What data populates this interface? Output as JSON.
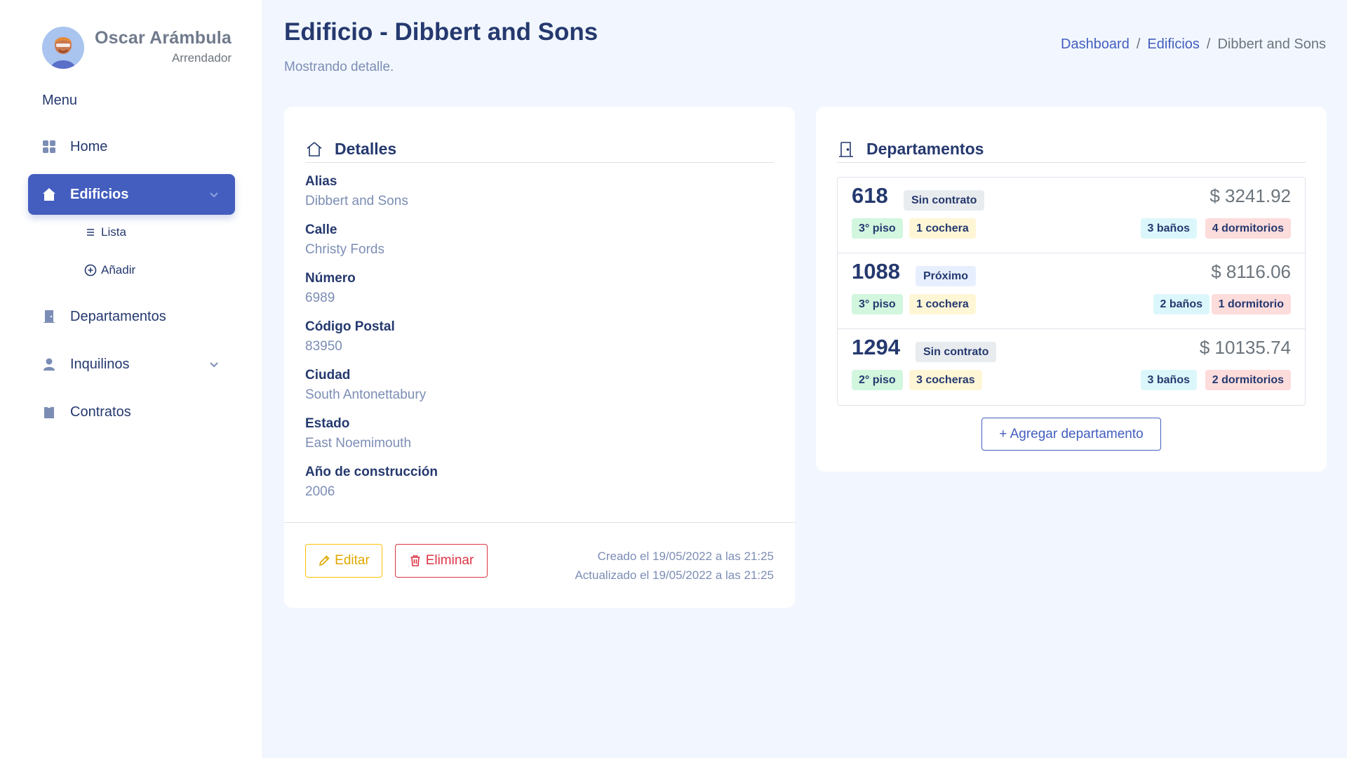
{
  "user": {
    "name": "Oscar Arámbula",
    "role": "Arrendador"
  },
  "sidebar": {
    "menu_title": "Menu",
    "items": [
      {
        "label": "Home",
        "icon": "grid-icon"
      },
      {
        "label": "Edificios",
        "icon": "house-icon",
        "active": true
      },
      {
        "label": "Departamentos",
        "icon": "door-icon"
      },
      {
        "label": "Inquilinos",
        "icon": "person-icon"
      },
      {
        "label": "Contratos",
        "icon": "clipboard-icon"
      }
    ],
    "subitems": [
      {
        "label": "Lista",
        "icon": "list-icon"
      },
      {
        "label": "Añadir",
        "icon": "plus-circle-icon"
      }
    ]
  },
  "header": {
    "title": "Edificio - Dibbert and Sons",
    "subtitle": "Mostrando detalle.",
    "breadcrumb": [
      "Dashboard",
      "Edificios",
      "Dibbert and Sons"
    ]
  },
  "details": {
    "title": "Detalles",
    "fields": [
      {
        "label": "Alias",
        "value": "Dibbert and Sons"
      },
      {
        "label": "Calle",
        "value": "Christy Fords"
      },
      {
        "label": "Número",
        "value": "6989"
      },
      {
        "label": "Código Postal",
        "value": "83950"
      },
      {
        "label": "Ciudad",
        "value": "South Antonettabury"
      },
      {
        "label": "Estado",
        "value": "East Noemimouth"
      },
      {
        "label": "Año de construcción",
        "value": "2006"
      }
    ],
    "edit_label": "Editar",
    "delete_label": "Eliminar",
    "created": "Creado el 19/05/2022 a las 21:25",
    "updated": "Actualizado el 19/05/2022 a las 21:25"
  },
  "apartments": {
    "title": "Departamentos",
    "items": [
      {
        "number": "618",
        "status": "Sin contrato",
        "price": "$ 3241.92",
        "floor": "3° piso",
        "garage": "1 cochera",
        "baths": "3 baños",
        "rooms": "4 dormitorios"
      },
      {
        "number": "1088",
        "status": "Próximo",
        "price": "$ 8116.06",
        "floor": "3° piso",
        "garage": "1 cochera",
        "baths": "2 baños",
        "rooms": "1 dormitorio"
      },
      {
        "number": "1294",
        "status": "Sin contrato",
        "price": "$ 10135.74",
        "floor": "2° piso",
        "garage": "3 cocheras",
        "baths": "3 baños",
        "rooms": "2 dormitorios"
      }
    ],
    "add_label": "+ Agregar departamento"
  },
  "colors": {
    "primary": "#435ebe",
    "text": "#25396f",
    "muted": "#7c8db5",
    "warning": "#ffc107",
    "danger": "#dc3545"
  }
}
